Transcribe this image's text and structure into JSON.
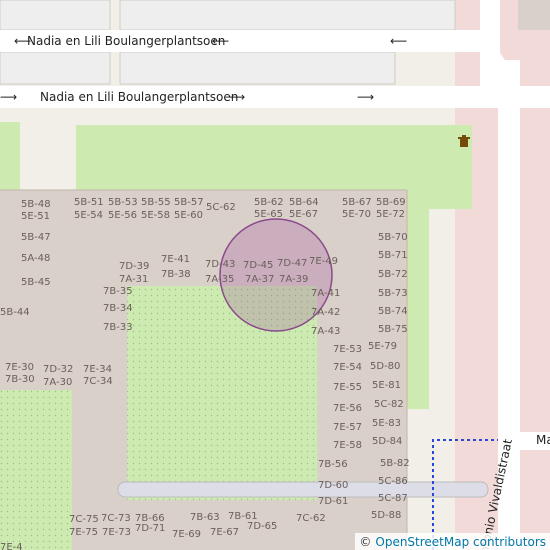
{
  "streets": {
    "top": "Nadia en Lili Boulangerplantsoen",
    "middle": "Nadia en Lili Boulangerplantsoen",
    "vertical": "Antonio Vivaldistraat",
    "right_edge": "Ma"
  },
  "attribution": {
    "symbol": "©",
    "text": "OpenStreetMap contributors"
  },
  "icons": {
    "poi": "waste-basket-icon",
    "arrows": "oneway-arrow-icon"
  },
  "colors": {
    "background": "#f2efe9",
    "building": "#d9d0c9",
    "building_outline": "#c3b6ac",
    "building_block": "#d9d0c9",
    "grass": "#cdebb0",
    "road": "#ffffff",
    "road_casing": "#ddd8d1",
    "commercial": "#f2dad9",
    "circle_fill": "rgba(160,70,160,0.25)",
    "circle_stroke": "#8b4a8b",
    "path": "#2b47d9"
  },
  "house_labels": [
    "5B-48",
    "5E-51",
    "5B-51",
    "5E-54",
    "5B-53",
    "5E-56",
    "5B-55",
    "5E-58",
    "5B-57",
    "5E-60",
    "5C-62",
    "5B-62",
    "5E-65",
    "5B-64",
    "5E-67",
    "5B-67",
    "5E-70",
    "5B-69",
    "5E-72",
    "5B-47",
    "5A-48",
    "5B-45",
    "5B-44",
    "5B-70",
    "5B-71",
    "5B-72",
    "5B-73",
    "5B-74",
    "5B-75",
    "7D-39",
    "7A-31",
    "7E-41",
    "7B-38",
    "7D-43",
    "7A-35",
    "7D-45",
    "7A-37",
    "7D-47",
    "7A-39",
    "7E-49",
    "7B-35",
    "7B-34",
    "7B-33",
    "7A-41",
    "7A-42",
    "7A-43",
    "7E-53",
    "5E-79",
    "7E-54",
    "5D-80",
    "7E-55",
    "5E-81",
    "7E-56",
    "5C-82",
    "7E-57",
    "5E-83",
    "7E-58",
    "5D-84",
    "7E-30",
    "7B-30",
    "7D-32",
    "7A-30",
    "7E-34",
    "7C-34",
    "7B-56",
    "5B-82",
    "5C-86",
    "7D-60",
    "5C-87",
    "7D-61",
    "5D-88",
    "7C-75",
    "7C-73",
    "7B-66",
    "7E-75",
    "7E-73",
    "7D-71",
    "7E-69",
    "7B-63",
    "7B-61",
    "7E-67",
    "7D-65",
    "7C-62",
    "7E-4"
  ]
}
